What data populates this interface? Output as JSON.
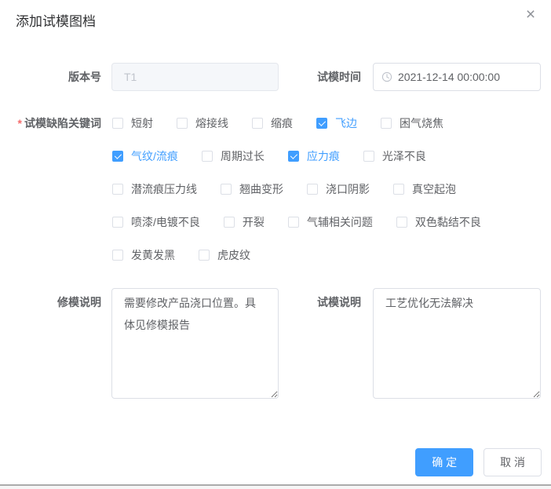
{
  "dialog": {
    "title": "添加试模图档",
    "close_icon": "×"
  },
  "colors": {
    "primary": "#409eff",
    "label_text": "#606266",
    "title_text": "#303133",
    "border": "#dcdfe6",
    "disabled_bg": "#f5f7fa",
    "disabled_text": "#c0c4cc",
    "required_mark": "#f56c6c"
  },
  "fields": {
    "version": {
      "label": "版本号",
      "value": "T1",
      "disabled": true
    },
    "trial_time": {
      "label": "试模时间",
      "value": "2021-12-14 00:00:00",
      "icon": "clock-icon"
    },
    "keywords": {
      "label": "试模缺陷关键词",
      "required_mark": "*",
      "rows": [
        [
          {
            "label": "短射",
            "checked": false
          },
          {
            "label": "熔接线",
            "checked": false
          },
          {
            "label": "缩痕",
            "checked": false
          },
          {
            "label": "飞边",
            "checked": true
          },
          {
            "label": "困气烧焦",
            "checked": false
          }
        ],
        [
          {
            "label": "气纹/流痕",
            "checked": true
          },
          {
            "label": "周期过长",
            "checked": false
          },
          {
            "label": "应力痕",
            "checked": true
          },
          {
            "label": "光泽不良",
            "checked": false
          }
        ],
        [
          {
            "label": "潜流痕压力线",
            "checked": false
          },
          {
            "label": "翘曲变形",
            "checked": false
          },
          {
            "label": "浇口阴影",
            "checked": false
          },
          {
            "label": "真空起泡",
            "checked": false
          }
        ],
        [
          {
            "label": "喷漆/电镀不良",
            "checked": false
          },
          {
            "label": "开裂",
            "checked": false
          },
          {
            "label": "气辅相关问题",
            "checked": false
          },
          {
            "label": "双色黏结不良",
            "checked": false
          }
        ],
        [
          {
            "label": "发黄发黑",
            "checked": false
          },
          {
            "label": "虎皮纹",
            "checked": false
          }
        ]
      ]
    },
    "repair_note": {
      "label": "修模说明",
      "value": "需要修改产品浇口位置。具体见修模报告"
    },
    "trial_note": {
      "label": "试模说明",
      "value": "工艺优化无法解决"
    }
  },
  "footer": {
    "confirm": "确 定",
    "cancel": "取 消"
  }
}
